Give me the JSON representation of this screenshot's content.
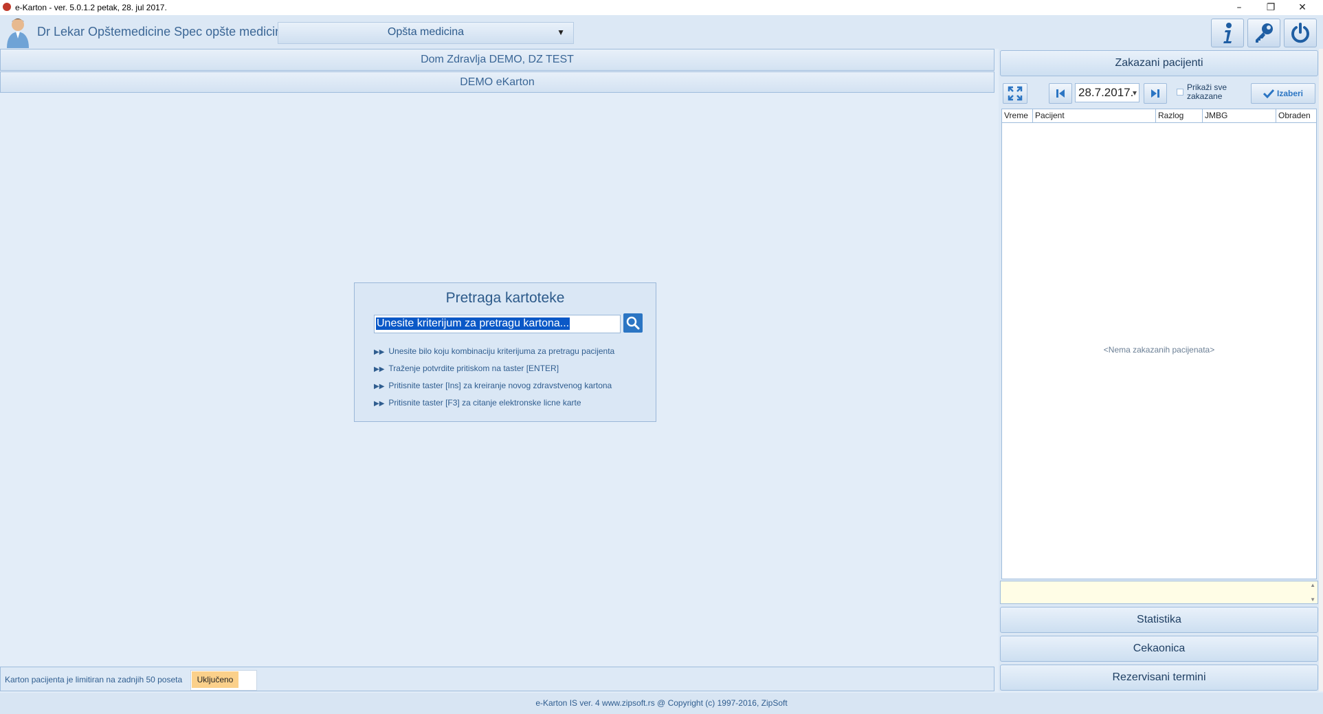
{
  "window": {
    "title": "e-Karton - ver. 5.0.1.2    petak,  28. jul 2017.",
    "minimize": "–",
    "restore": "❐",
    "close": "✕"
  },
  "header": {
    "doctor": "Dr Lekar Opštemedicine Spec  opšte medicine",
    "specialty": "Opšta medicina",
    "specialty_arrow": "▼",
    "icons": [
      "info-icon",
      "key-icon",
      "power-icon"
    ]
  },
  "main": {
    "institution": "Dom Zdravlja DEMO, DZ TEST",
    "subtitle": "DEMO eKarton",
    "search": {
      "title": "Pretraga kartoteke",
      "input_value": "Unesite kriterijum za pretragu kartona...",
      "hints": [
        "Unesite bilo koju kombinaciju kriterijuma za pretragu pacijenta",
        "Traženje potvrdite pritiskom na taster [ENTER]",
        "Pritisnite taster [Ins] za kreiranje novog zdravstvenog kartona",
        "Pritisnite taster [F3] za citanje elektronske licne karte"
      ]
    }
  },
  "status": {
    "text": "Karton pacijenta je limitiran na zadnjih 50 poseta",
    "badge": "Uključeno"
  },
  "footer": "e-Karton IS ver. 4  www.zipsoft.rs @ Copyright (c) 1997-2016, ZipSoft",
  "right_panel": {
    "title": "Zakazani pacijenti",
    "date": "28.7.2017.",
    "date_arrow": "▾",
    "show_all": "Prikaži sve zakazane",
    "select_button": "Izaberi",
    "columns": [
      "Vreme",
      "Pacijent",
      "Razlog",
      "JMBG",
      "Obraden"
    ],
    "empty": "<Nema zakazanih pacijenata>",
    "buttons": [
      "Statistika",
      "Cekaonica",
      "Rezervisani termini"
    ]
  },
  "colors": {
    "accent": "#2b75c3",
    "panel": "#dce8f5",
    "badge": "#fbd08a"
  }
}
